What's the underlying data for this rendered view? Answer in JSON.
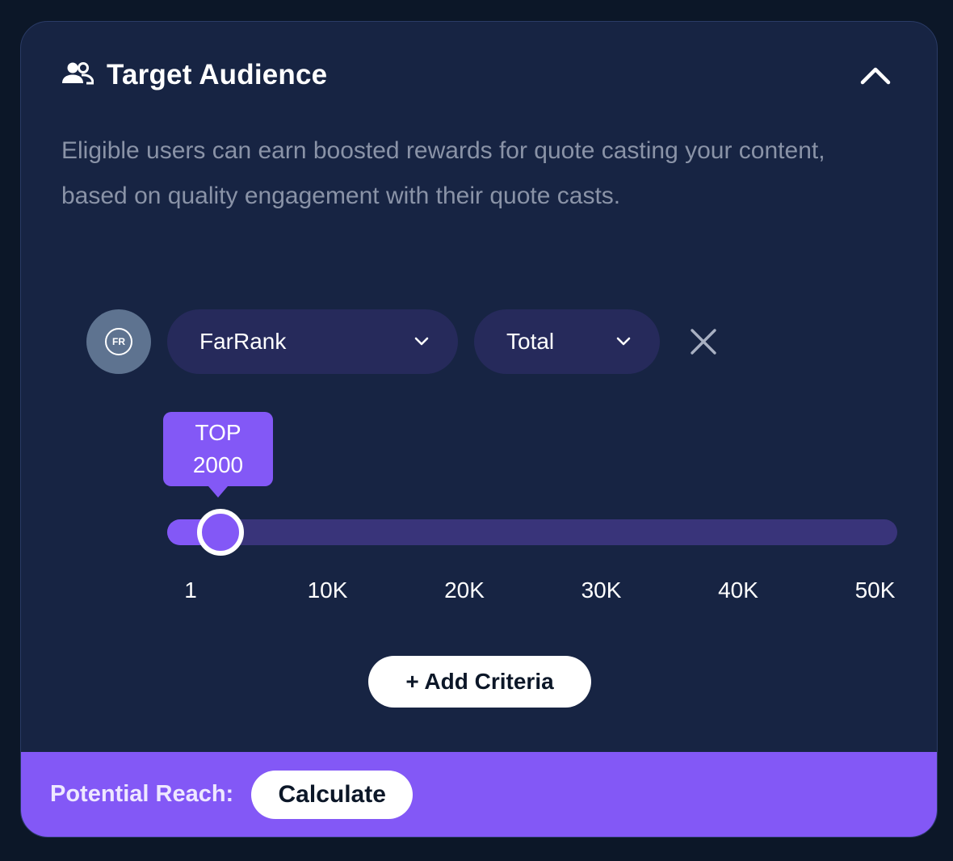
{
  "header": {
    "title": "Target Audience",
    "icon": "users-icon",
    "collapse_icon": "chevron-up-icon"
  },
  "description": {
    "line1": "Eligible users can earn boosted rewards for quote casting your content,",
    "line2": "based on quality engagement with their quote casts."
  },
  "criteria": {
    "badge_text": "FR",
    "metric_dropdown": {
      "selected": "FarRank"
    },
    "scope_dropdown": {
      "selected": "Total"
    },
    "remove_icon": "close-icon"
  },
  "slider": {
    "tooltip_prefix": "TOP",
    "tooltip_value": "2000",
    "value": 2000,
    "min": 1,
    "max": 50000,
    "ticks": [
      "1",
      "10K",
      "20K",
      "30K",
      "40K",
      "50K"
    ]
  },
  "actions": {
    "add_criteria_label": "+ Add Criteria"
  },
  "footer": {
    "reach_label": "Potential Reach:",
    "calculate_label": "Calculate"
  },
  "colors": {
    "background": "#0c1728",
    "card": "#172443",
    "accent": "#8358f6",
    "track": "#39347a",
    "dropdown": "#262a5b",
    "muted_text": "#8a93a7"
  }
}
